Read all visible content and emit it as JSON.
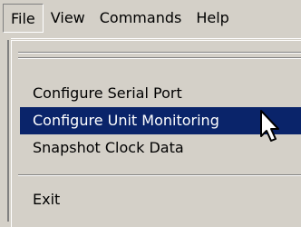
{
  "menubar": {
    "items": [
      {
        "label": "File",
        "open": true
      },
      {
        "label": "View"
      },
      {
        "label": "Commands"
      },
      {
        "label": "Help"
      }
    ]
  },
  "file_menu": {
    "items": [
      {
        "label": "Configure Serial Port"
      },
      {
        "label": "Configure Unit Monitoring",
        "highlighted": true
      },
      {
        "label": "Snapshot Clock Data"
      },
      {
        "label": "Exit"
      }
    ]
  },
  "colors": {
    "face": "#d4d0c8",
    "highlight": "#0a246a",
    "highlight_text": "#ffffff"
  }
}
